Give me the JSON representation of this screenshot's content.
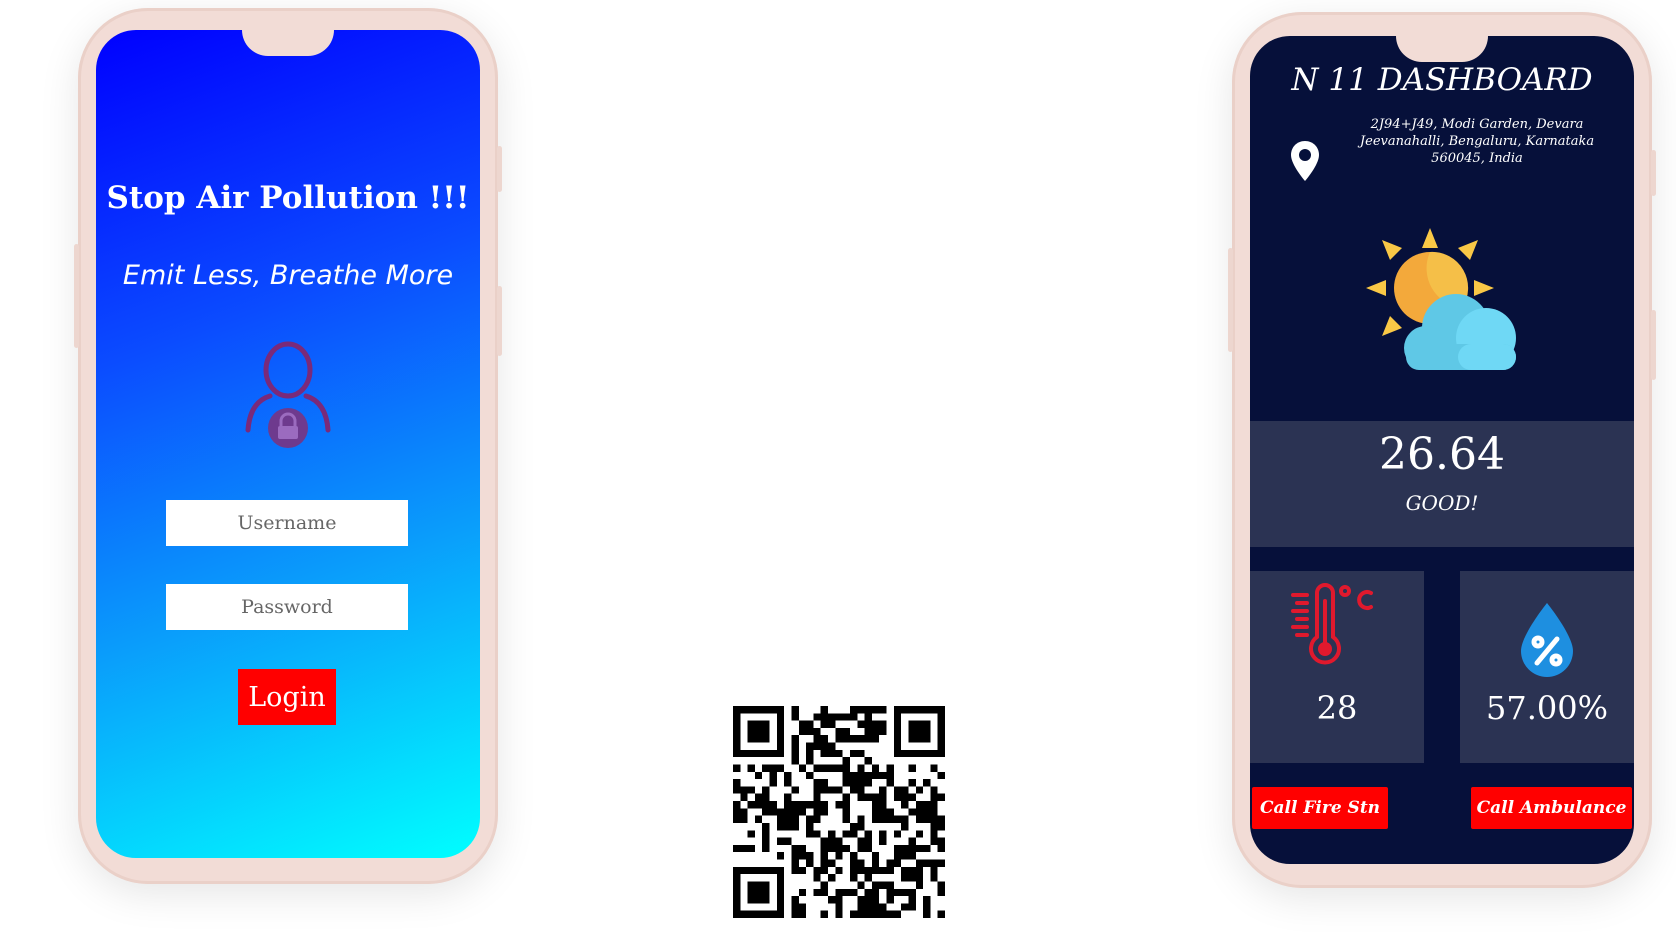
{
  "login_screen": {
    "title": "Stop Air Pollution !!!",
    "tagline": "Emit Less, Breathe More",
    "username_placeholder": "Username",
    "password_placeholder": "Password",
    "login_label": "Login",
    "user_icon": "user-lock-icon"
  },
  "qr_code": {
    "icon": "qr-code"
  },
  "dashboard": {
    "title": "N 11 DASHBOARD",
    "address": "2J94+J49, Modi Garden, Devara Jeevanahalli, Bengaluru, Karnataka 560045, India",
    "location_icon": "map-pin-icon",
    "weather_icon": "partly-cloudy-icon",
    "aqi_value": "26.64",
    "aqi_status": "GOOD!",
    "temperature": "28",
    "temperature_icon": "thermometer-celsius-icon",
    "humidity": "57.00%",
    "humidity_icon": "humidity-drop-icon",
    "call_fire_label": "Call Fire Stn",
    "call_ambulance_label": "Call Ambulance"
  },
  "colors": {
    "gradient_top": "#0000ff",
    "gradient_bottom": "#00ffff",
    "dashboard_bg": "#06103a",
    "panel_bg": "#2b3353",
    "button_red": "#ff0000",
    "phone_frame": "#f2dcd6"
  }
}
